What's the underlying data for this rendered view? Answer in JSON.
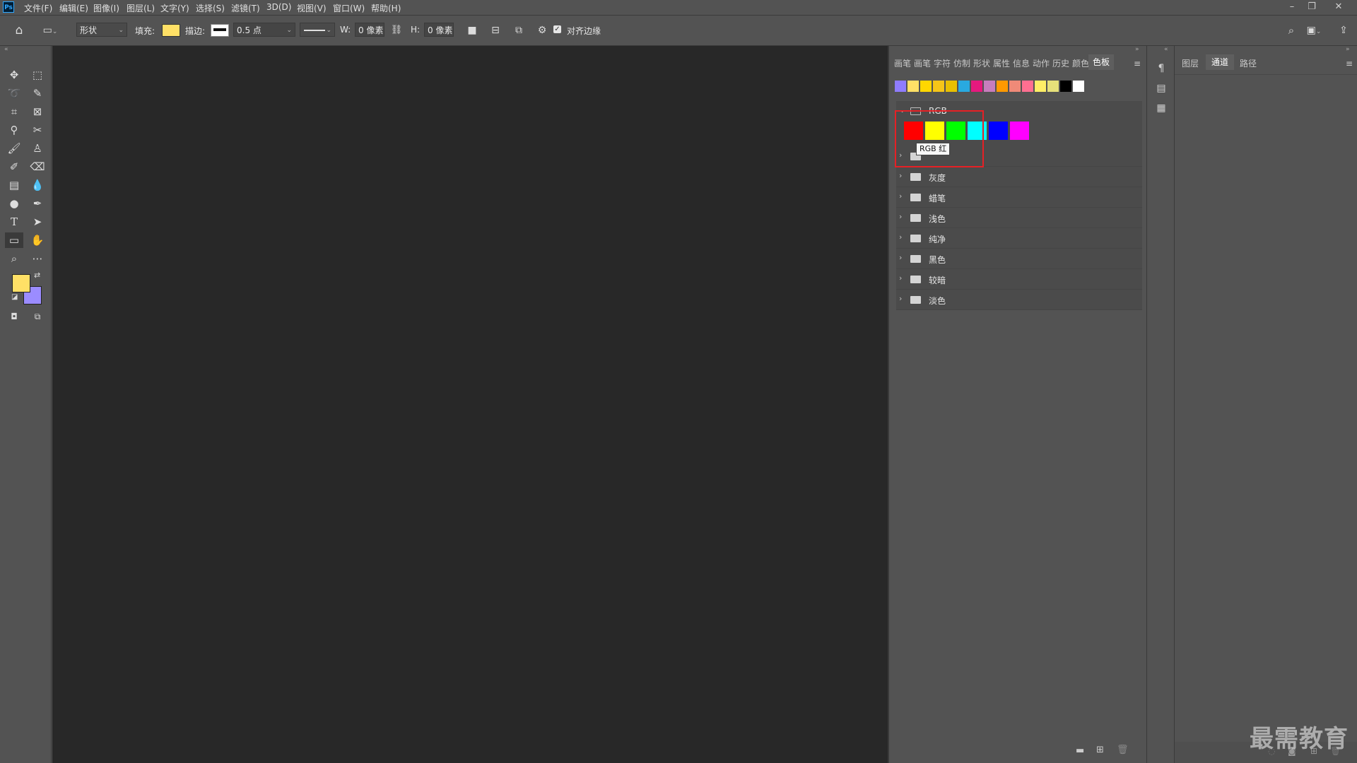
{
  "app": {
    "logo_text": "Ps"
  },
  "menu": [
    "文件(F)",
    "编辑(E)",
    "图像(I)",
    "图层(L)",
    "文字(Y)",
    "选择(S)",
    "滤镜(T)",
    "3D(D)",
    "视图(V)",
    "窗口(W)",
    "帮助(H)"
  ],
  "options": {
    "mode_value": "形状",
    "fill_label": "填充:",
    "fill_color": "#ffe066",
    "stroke_label": "描边:",
    "stroke_width": "0.5 点",
    "w_label": "W:",
    "w_value": "0 像素",
    "h_label": "H:",
    "h_value": "0 像素",
    "align_edges_label": "对齐边缘",
    "align_edges_checked": true
  },
  "colors": {
    "foreground": "#ffe066",
    "background": "#9b8cff",
    "highlight_box": "#e62025"
  },
  "swatches_panel": {
    "tabs": [
      "画笔",
      "画笔",
      "字符",
      "仿制",
      "形状",
      "属性",
      "信息",
      "动作",
      "历史",
      "颜色",
      "色板"
    ],
    "active_tab": "色板",
    "recent_swatches": [
      "#8f7cff",
      "#ffe066",
      "#ffd700",
      "#f5c518",
      "#e8c000",
      "#29a9e0",
      "#e6197e",
      "#c77dbd",
      "#ff9900",
      "#f08a78",
      "#ff6f91",
      "#ffee66",
      "#e6e07a",
      "#000000",
      "#ffffff"
    ],
    "groups": [
      {
        "name": "RGB",
        "expanded": true,
        "swatches": [
          "#ff0000",
          "#ffff00",
          "#00ff00",
          "#00ffff",
          "#0000ff",
          "#ff00ff"
        ]
      },
      {
        "name": "",
        "expanded": false
      },
      {
        "name": "灰度",
        "expanded": false
      },
      {
        "name": "蜡笔",
        "expanded": false
      },
      {
        "name": "浅色",
        "expanded": false
      },
      {
        "name": "纯净",
        "expanded": false
      },
      {
        "name": "黑色",
        "expanded": false
      },
      {
        "name": "较暗",
        "expanded": false
      },
      {
        "name": "淡色",
        "expanded": false
      }
    ],
    "tooltip": "RGB 红"
  },
  "right_panel": {
    "tabs": [
      "图层",
      "通道",
      "路径"
    ],
    "active_tab": "通道"
  },
  "watermark": "最需教育"
}
